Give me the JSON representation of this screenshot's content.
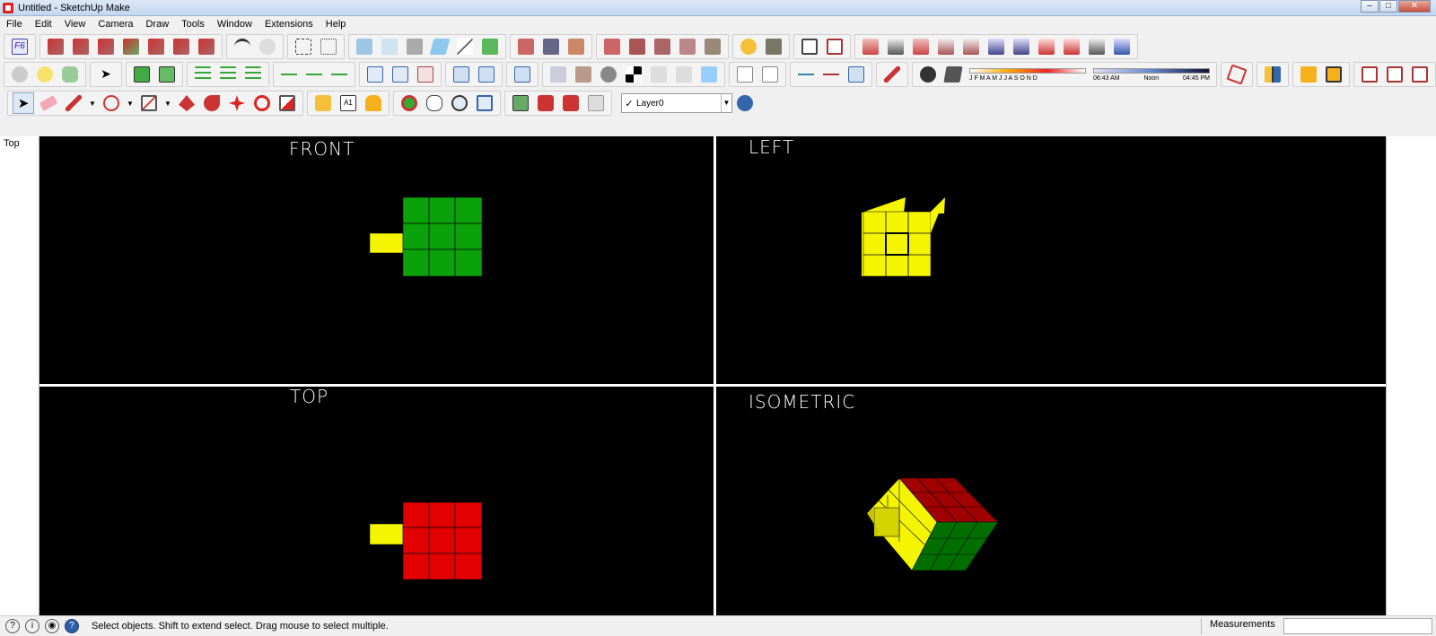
{
  "window": {
    "title": "Untitled - SketchUp Make"
  },
  "menu": [
    "File",
    "Edit",
    "View",
    "Camera",
    "Draw",
    "Tools",
    "Window",
    "Extensions",
    "Help"
  ],
  "layer": {
    "checked": "✓",
    "name": "Layer0"
  },
  "shadow": {
    "months": "J F M A M J J A S O N D",
    "time_start": "06:43 AM",
    "time_mid": "Noon",
    "time_end": "04:45 PM"
  },
  "viewport": {
    "scene_tab": "Top",
    "front_label": "FRONT",
    "left_label": "LEFT",
    "top_label": "TOP",
    "iso_label": "ISOMETRIC",
    "colors": {
      "green": "#0aa10a",
      "yellow": "#f5f500",
      "red": "#e20000",
      "dark_red": "#a00000",
      "dark_green": "#006f00"
    }
  },
  "status": {
    "message": "Select objects. Shift to extend select. Drag mouse to select multiple.",
    "measurements_label": "Measurements",
    "measurements_value": ""
  }
}
